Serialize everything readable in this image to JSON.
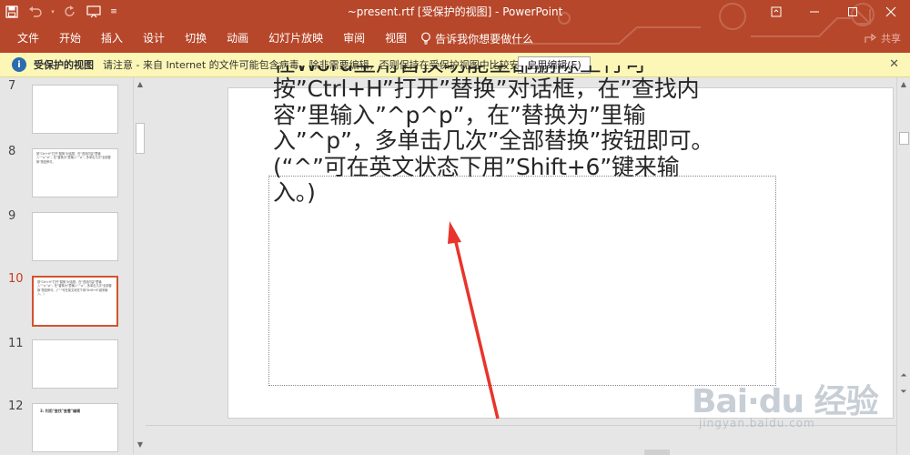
{
  "window": {
    "title": "~present.rtf [受保护的视图]  -  PowerPoint"
  },
  "menu": {
    "items": [
      "文件",
      "开始",
      "插入",
      "设计",
      "切换",
      "动画",
      "幻灯片放映",
      "审阅",
      "视图"
    ],
    "tell_me": "告诉我你想要做什么",
    "share": "共享"
  },
  "protected_bar": {
    "title": "受保护的视图",
    "message": "请注意 - 来自 Internet 的文件可能包含病毒。除非需要编辑，否则保持在受保护视图中比较安全。",
    "enable_button": "启用编辑(E)"
  },
  "thumbnails": [
    {
      "number": "7",
      "text": ""
    },
    {
      "number": "8",
      "text": "按\"Ctrl+H\"打开\"替换\"对话框，在\"查找内容\"里输入\"^p^p\"，在\"替换为\"里输入\"^p\"，多单击几次\"全部替换\"按钮即可。"
    },
    {
      "number": "9",
      "text": ""
    },
    {
      "number": "10",
      "text": "按\"Ctrl+H\"打开\"替换\"对话框，在\"查找内容\"里输入\"^p^p\"，在\"替换为\"里输入\"^p\"，多单击几次\"全部替换\"按钮即可。(\"^\"可在英文状态下用\"Shift+6\"键来输入。)"
    },
    {
      "number": "11",
      "text": ""
    },
    {
      "number": "12",
      "text": "3. 利用\"查找\"查看\"编辑"
    }
  ],
  "slide": {
    "lines": [
      "在Word里用替换功能全部删除空行可",
      "按”Ctrl+H”打开”替换”对话框，在”查找内",
      "容”里输入”^p^p”，在”替换为”里输",
      "入”^p”，多单击几次”全部替换”按钮即可。",
      "(“^”可在英文状态下用”Shift+6”键来输",
      "入。)"
    ]
  },
  "watermark": {
    "main": "Bai·du 经验",
    "sub": "jingyan.baidu.com"
  },
  "colors": {
    "accent": "#b7472a",
    "message_bar": "#fcf7b6",
    "active_thumb_border": "#d2542f",
    "arrow": "#e8342c"
  }
}
